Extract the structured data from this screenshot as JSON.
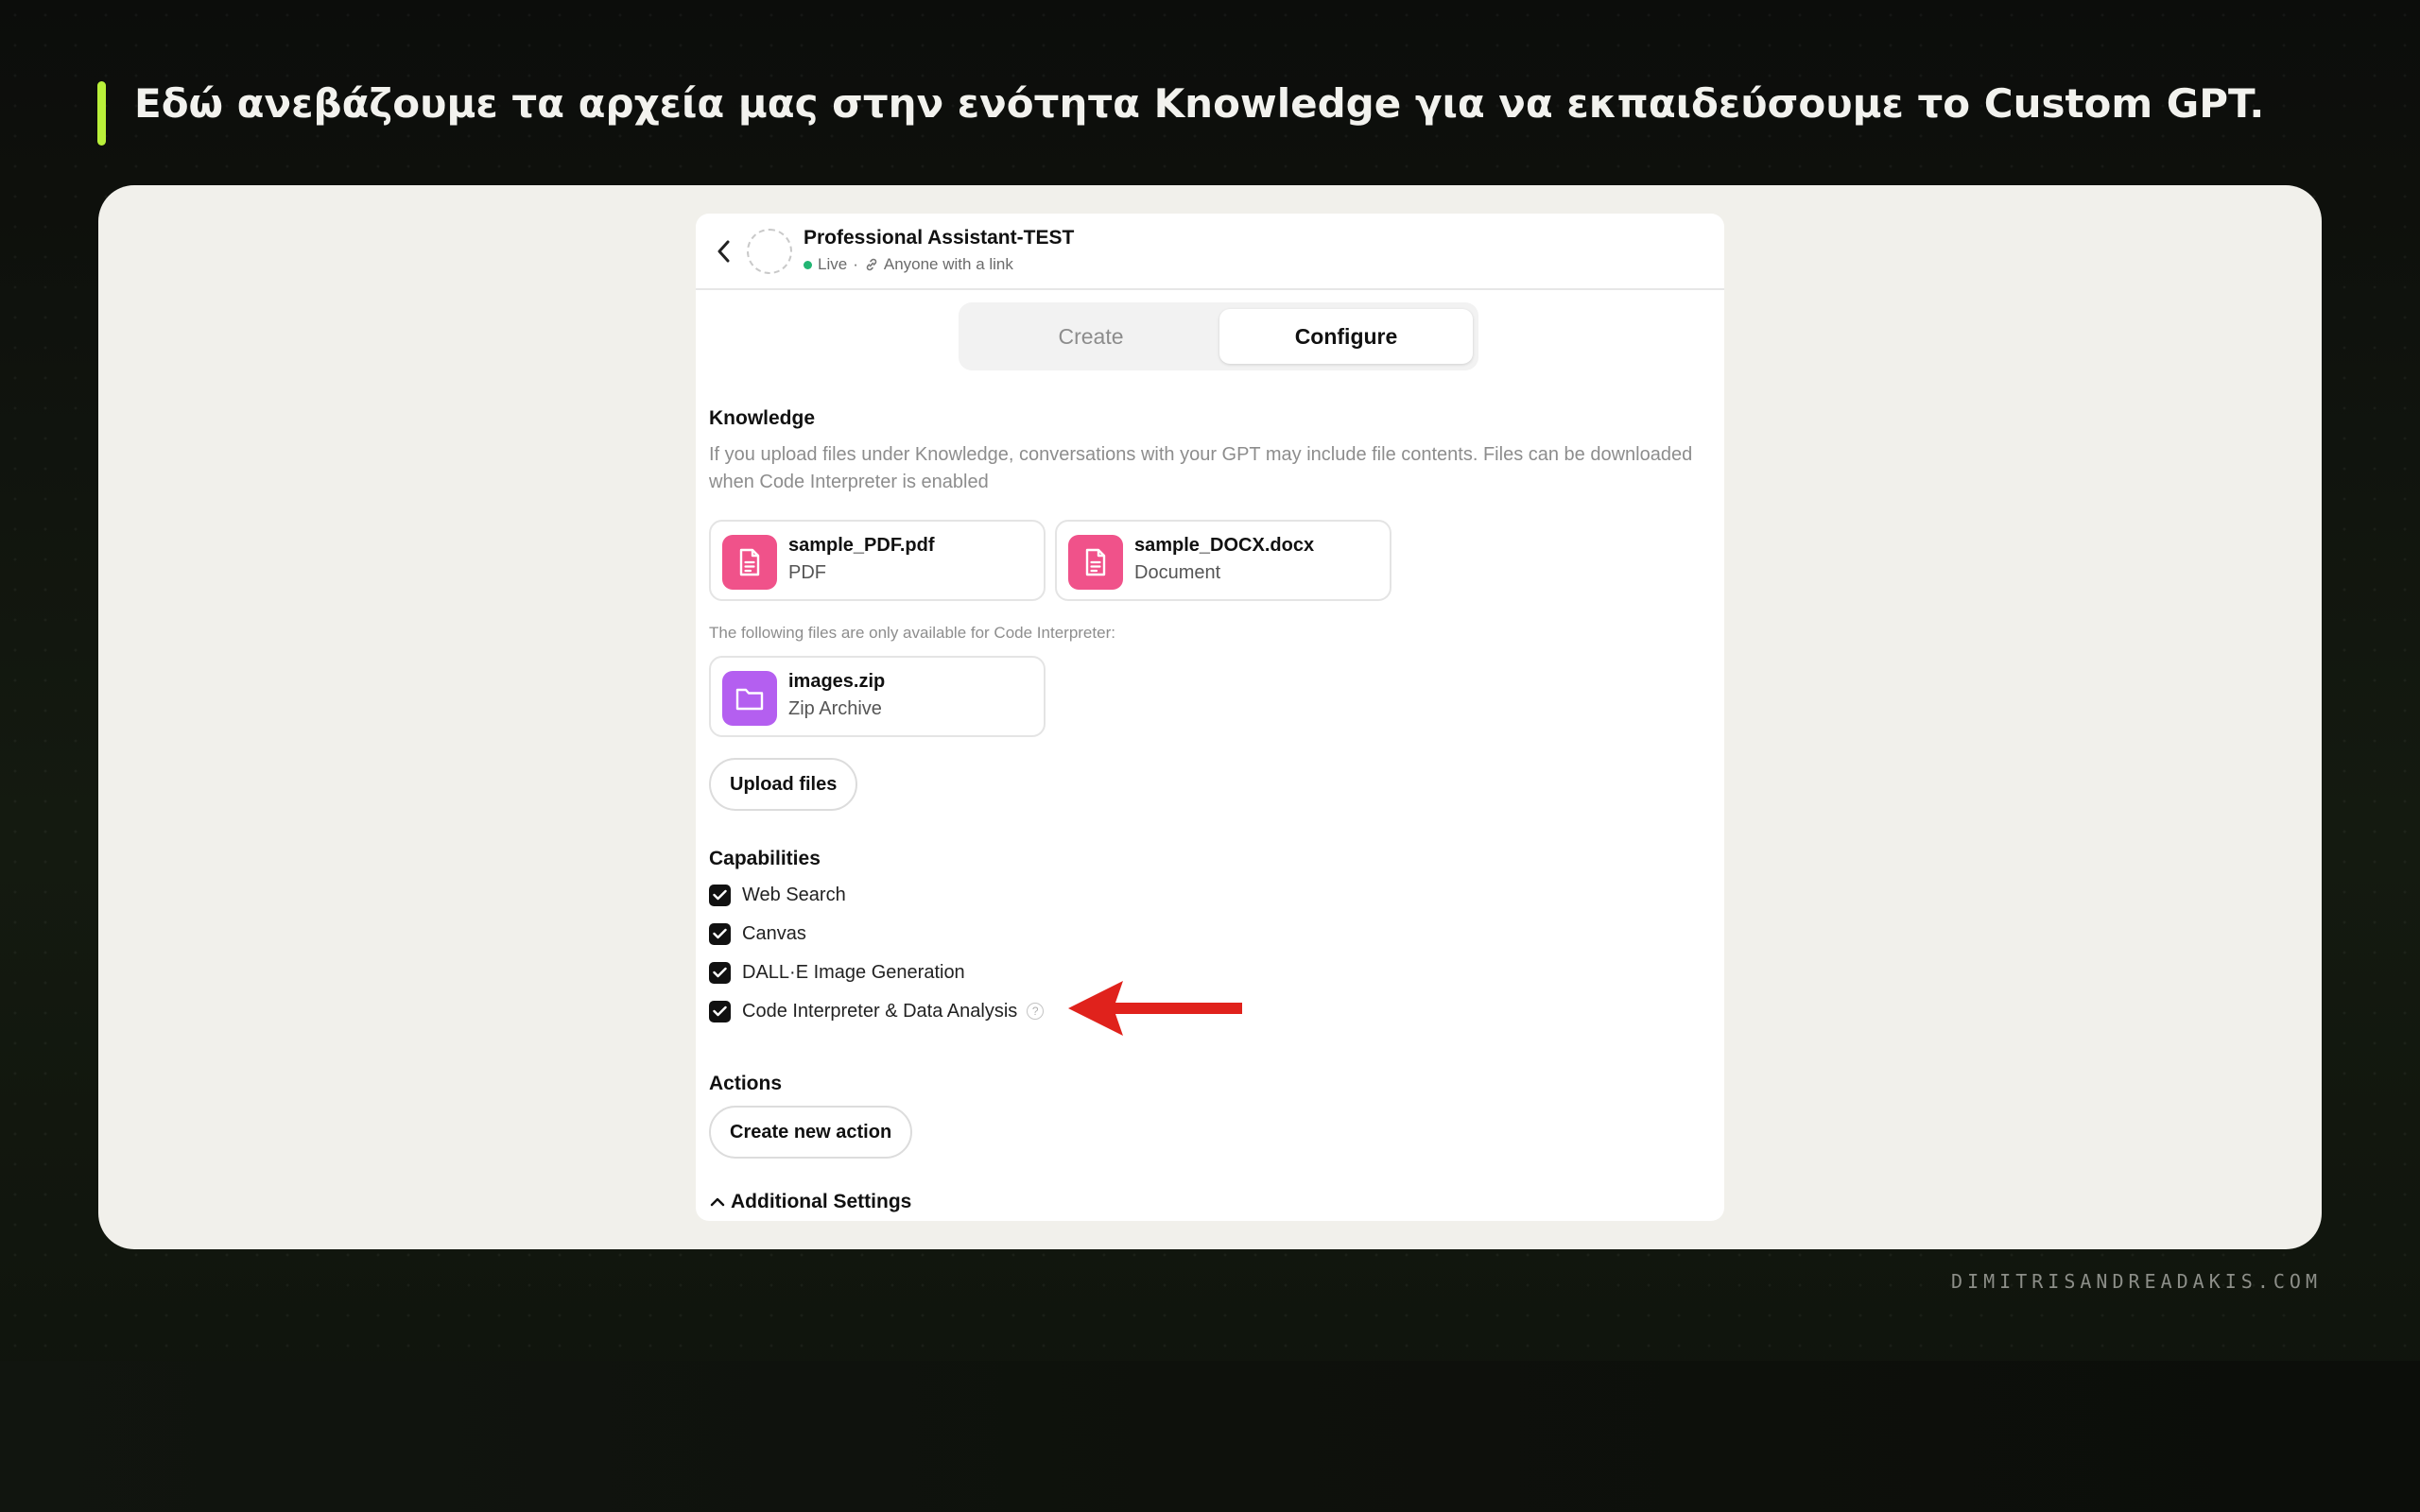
{
  "slide": {
    "headline": "Εδώ ανεβάζουμε τα αρχεία μας στην ενότητα Knowledge για να εκπαιδεύσουμε το Custom GPT.",
    "watermark": "DIMITRISANDREADAKIS.COM",
    "accent_color": "#b9f03a"
  },
  "header": {
    "back_icon": "chevron-left-icon",
    "name": "Professional Assistant-TEST",
    "status": "Live",
    "separator": "·",
    "visibility": "Anyone with a link",
    "status_color": "#22b573"
  },
  "tabs": [
    {
      "label": "Create",
      "active": false
    },
    {
      "label": "Configure",
      "active": true
    }
  ],
  "knowledge": {
    "title": "Knowledge",
    "description": "If you upload files under Knowledge, conversations with your GPT may include file contents. Files can be downloaded when Code Interpreter is enabled",
    "files": [
      {
        "name": "sample_PDF.pdf",
        "type": "PDF",
        "icon": "document-icon",
        "color": "#f0528a"
      },
      {
        "name": "sample_DOCX.docx",
        "type": "Document",
        "icon": "document-icon",
        "color": "#f0528a"
      }
    ],
    "code_interpreter_note": "The following files are only available for Code Interpreter:",
    "ci_files": [
      {
        "name": "images.zip",
        "type": "Zip Archive",
        "icon": "folder-icon",
        "color": "#b45ff0"
      }
    ],
    "upload_label": "Upload files"
  },
  "capabilities": {
    "title": "Capabilities",
    "items": [
      {
        "label": "Web Search",
        "checked": true
      },
      {
        "label": "Canvas",
        "checked": true
      },
      {
        "label": "DALL·E Image Generation",
        "checked": true
      },
      {
        "label": "Code Interpreter & Data Analysis",
        "checked": true
      }
    ],
    "help_glyph": "?"
  },
  "actions": {
    "title": "Actions",
    "create_label": "Create new action"
  },
  "additional": {
    "label": "Additional Settings",
    "icon": "chevron-up-icon"
  },
  "annotation": {
    "icon": "red-arrow-icon",
    "color": "#e0221c"
  }
}
